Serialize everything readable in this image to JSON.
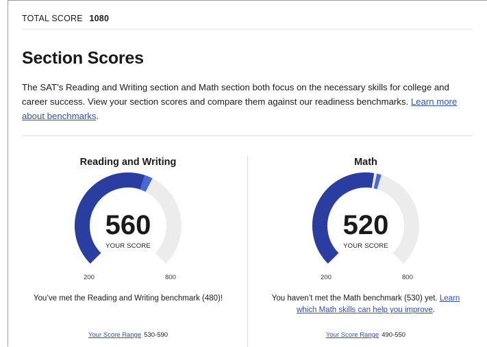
{
  "total": {
    "label": "TOTAL SCORE",
    "value": "1080"
  },
  "section": {
    "title": "Section Scores",
    "description": "The SAT’s Reading and Writing section and Math section both focus on the necessary skills for college and career success. View your section scores and compare them against our readiness benchmarks. ",
    "link": "Learn more about benchmarks",
    "description_end": "."
  },
  "colors": {
    "fill": "#2a3da0",
    "marker": "#4768d6",
    "track": "#ececec",
    "link": "#2d4fc4"
  },
  "panels": [
    {
      "title": "Reading and Writing",
      "score": "560",
      "score_value": 560,
      "benchmark_value": 480,
      "min": 200,
      "max": 800,
      "min_label": "200",
      "max_label": "800",
      "your_score_label": "YOUR SCORE",
      "message": "You’ve met the Reading and Writing benchmark (480)!",
      "range_label": "Your Score Range",
      "range_value": "530-590"
    },
    {
      "title": "Math",
      "score": "520",
      "score_value": 520,
      "benchmark_value": 530,
      "min": 200,
      "max": 800,
      "min_label": "200",
      "max_label": "800",
      "your_score_label": "YOUR SCORE",
      "message_part1": "You haven’t met the Math benchmark (530) yet. ",
      "message_link": "Learn which Math skills can help you improve",
      "message_end": ".",
      "range_label": "Your Score Range",
      "range_value": "490-550"
    }
  ]
}
